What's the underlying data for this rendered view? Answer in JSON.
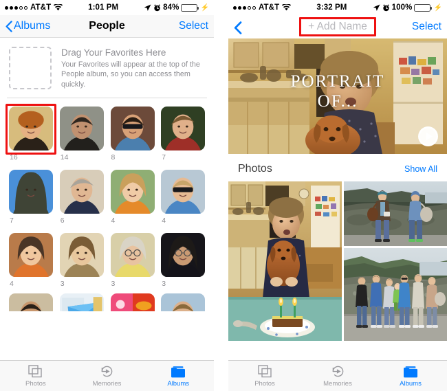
{
  "left": {
    "status": {
      "signal_filled": 3,
      "signal_empty": 2,
      "carrier": "AT&T",
      "wifi_icon": "wifi-icon",
      "time": "1:01 PM",
      "location_icon": "location-arrow-icon",
      "alarm_icon": "alarm-clock-icon",
      "battery_percent": "84%",
      "battery_level": 84,
      "charging_icon": "lightning-bolt-icon"
    },
    "nav": {
      "back_label": "Albums",
      "back_icon": "chevron-left-icon",
      "title": "People",
      "right_label": "Select"
    },
    "favorites": {
      "dropzone_name": "favorites-dropzone",
      "title": "Drag Your Favorites Here",
      "subtitle": "Your Favorites will appear at the top of the People album, so you can access them quickly."
    },
    "people": [
      {
        "count": "16",
        "highlighted": true,
        "alt": "woman-short-red-hair-kitchen"
      },
      {
        "count": "14",
        "highlighted": false,
        "alt": "man-dark-shirt-outdoors"
      },
      {
        "count": "8",
        "highlighted": false,
        "alt": "man-sunglasses-blue-shirt"
      },
      {
        "count": "7",
        "highlighted": false,
        "alt": "man-red-shirt-trees"
      },
      {
        "count": "7",
        "highlighted": false,
        "alt": "man-hood-blue-sky"
      },
      {
        "count": "6",
        "highlighted": false,
        "alt": "older-man-navy-sweater"
      },
      {
        "count": "4",
        "highlighted": false,
        "alt": "girl-orange-top"
      },
      {
        "count": "4",
        "highlighted": false,
        "alt": "man-sunglasses-child"
      },
      {
        "count": "4",
        "highlighted": false,
        "alt": "toddler-orange-stripe"
      },
      {
        "count": "3",
        "highlighted": false,
        "alt": "woman-sepia-smiling"
      },
      {
        "count": "3",
        "highlighted": false,
        "alt": "elderly-woman-glasses-yellow"
      },
      {
        "count": "3",
        "highlighted": false,
        "alt": "woman-dark-hair-dark-room"
      }
    ],
    "people_peek": [
      {
        "alt": "man-hands-on-head"
      },
      {
        "alt": "blue-paper-craft"
      },
      {
        "alt": "colorful-collage"
      },
      {
        "alt": "man-blue-background"
      }
    ],
    "tabs": [
      {
        "label": "Photos",
        "icon": "photos-squares-icon",
        "active": false
      },
      {
        "label": "Memories",
        "icon": "memories-replay-icon",
        "active": false
      },
      {
        "label": "Albums",
        "icon": "albums-folder-icon",
        "active": true
      }
    ]
  },
  "right": {
    "status": {
      "signal_filled": 3,
      "signal_empty": 2,
      "carrier": "AT&T",
      "wifi_icon": "wifi-icon",
      "time": "3:32 PM",
      "location_icon": "location-arrow-icon",
      "alarm_icon": "alarm-clock-icon",
      "battery_percent": "100%",
      "battery_level": 100,
      "charging_icon": "lightning-bolt-icon"
    },
    "nav": {
      "back_icon": "chevron-left-icon",
      "add_name_label": "+ Add Name",
      "right_label": "Select"
    },
    "hero": {
      "title_line1": "PORTRAIT",
      "title_line2": "OF...",
      "alt": "woman-holding-dachshund-in-kitchen",
      "play_icon": "play-button-icon"
    },
    "photos_section": {
      "title": "Photos",
      "link_label": "Show All",
      "items": [
        {
          "alt": "woman-with-dachshund-birthday-cake-candles"
        },
        {
          "alt": "two-women-standing-stone-wall-cliff"
        },
        {
          "alt": "family-group-photo-stone-wall-coast"
        }
      ]
    },
    "tabs": [
      {
        "label": "Photos",
        "icon": "photos-squares-icon",
        "active": false
      },
      {
        "label": "Memories",
        "icon": "memories-replay-icon",
        "active": false
      },
      {
        "label": "Albums",
        "icon": "albums-folder-icon",
        "active": true
      }
    ]
  },
  "colors": {
    "accent_blue": "#007aff",
    "highlight_red": "#ee1111",
    "battery_green": "#4cd964",
    "secondary_gray": "#8e8e93"
  }
}
